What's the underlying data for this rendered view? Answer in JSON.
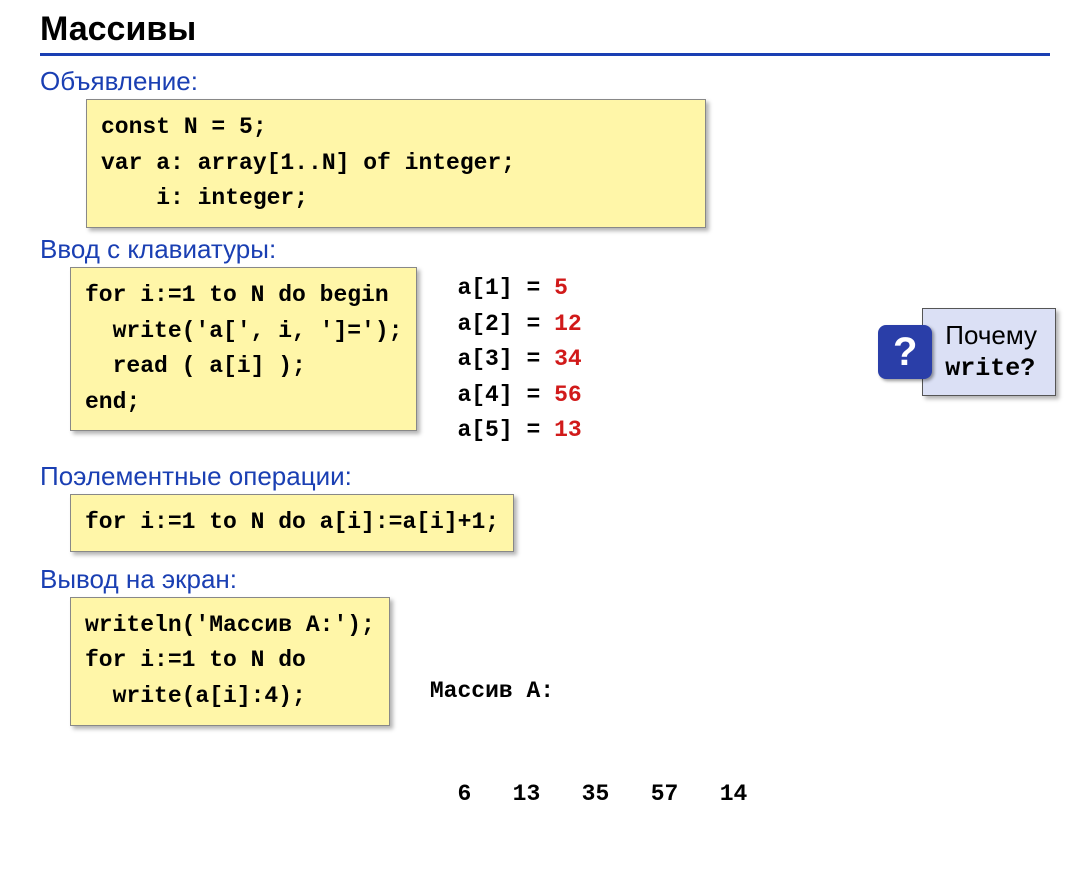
{
  "title": "Массивы",
  "sections": {
    "declaration": {
      "label": "Объявление:",
      "code": "const N = 5;\nvar a: array[1..N] of integer;\n    i: integer;"
    },
    "input": {
      "label": "Ввод с клавиатуры:",
      "code": "for i:=1 to N do begin\n  write('a[', i, ']=');\n  read ( a[i] );\nend;",
      "values": [
        {
          "idx": "a[1] = ",
          "val": "5"
        },
        {
          "idx": "a[2] = ",
          "val": "12"
        },
        {
          "idx": "a[3] = ",
          "val": "34"
        },
        {
          "idx": "a[4] = ",
          "val": "56"
        },
        {
          "idx": "a[5] = ",
          "val": "13"
        }
      ]
    },
    "elementwise": {
      "label": "Поэлементные операции:",
      "code": "for i:=1 to N do a[i]:=a[i]+1;"
    },
    "output": {
      "label": "Вывод на экран:",
      "code": "writeln('Массив A:');\nfor i:=1 to N do\n  write(a[i]:4);",
      "result_label": "Массив A:",
      "result_values": "  6   13   35   57   14"
    }
  },
  "callout": {
    "badge": "?",
    "line1": "Почему",
    "line2": "write?"
  }
}
